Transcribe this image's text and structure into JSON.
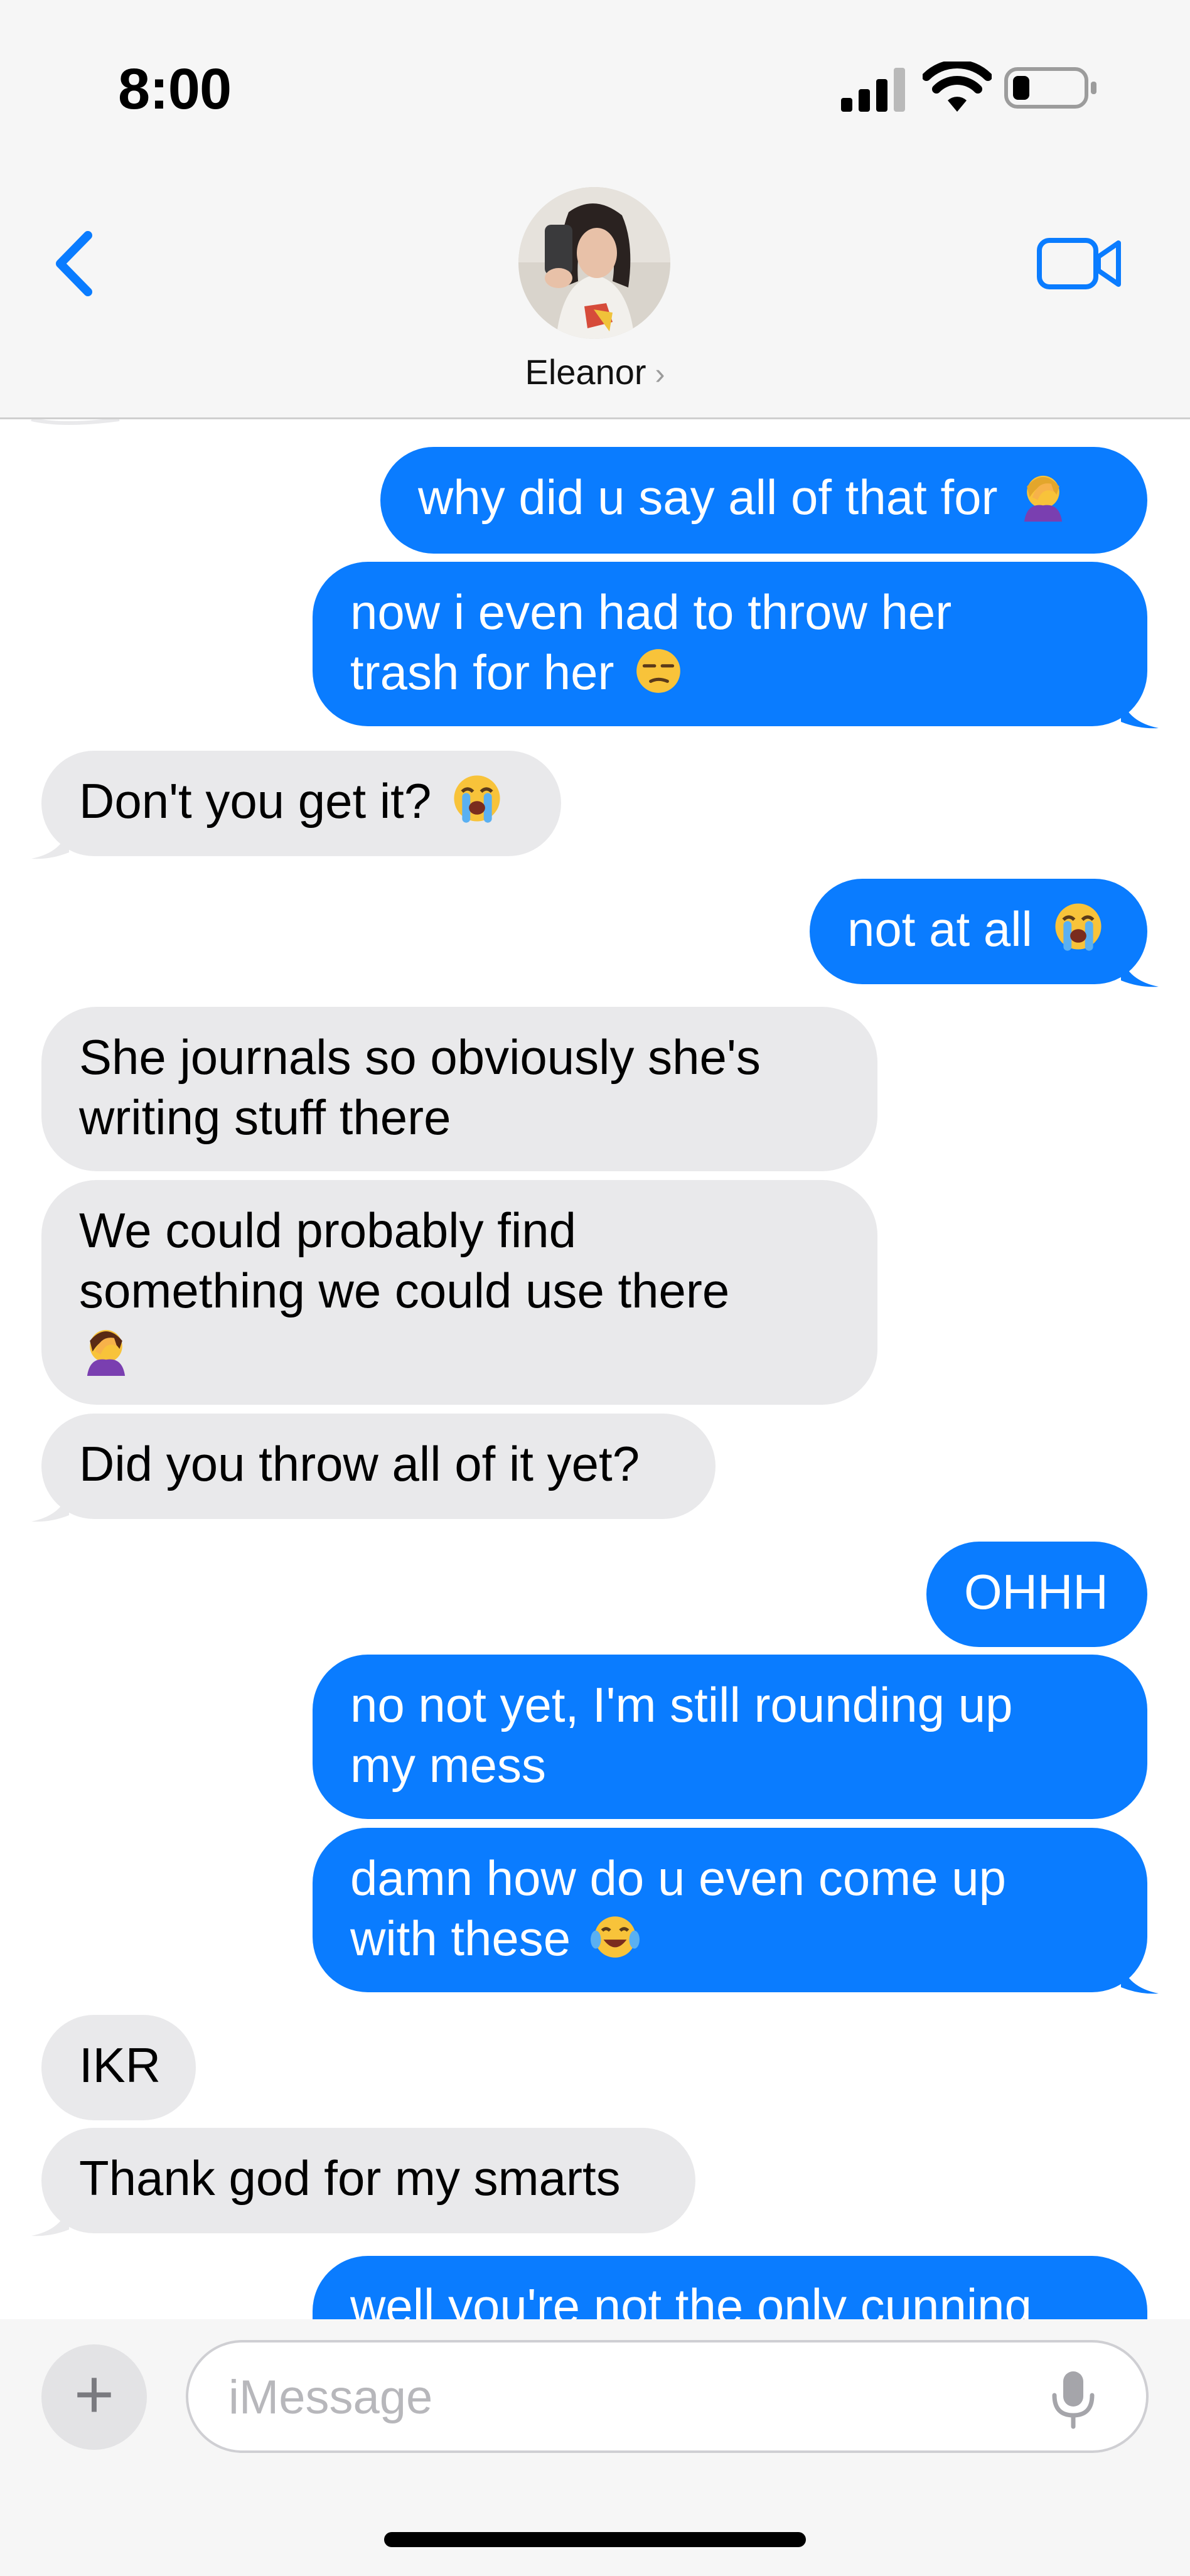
{
  "status_bar": {
    "time": "8:00"
  },
  "header": {
    "contact_name": "Eleanor",
    "contact_chevron": "›",
    "back_icon": "chevron-left-icon",
    "video_icon": "video-camera-icon"
  },
  "messages": [
    {
      "from": "me",
      "text": "why did u say all of that for",
      "emoji": "woman-facepalming"
    },
    {
      "from": "me",
      "text": "now i even had to throw her",
      "text2": "trash for her",
      "emoji": "unamused-face"
    },
    {
      "from": "them",
      "text": "Don't you get it?",
      "emoji": "loudly-crying-face"
    },
    {
      "from": "me",
      "text": "not at all",
      "emoji": "loudly-crying-face"
    },
    {
      "from": "them",
      "text": "She journals so obviously she's",
      "text2": "writing stuff there"
    },
    {
      "from": "them",
      "text": "We could probably find",
      "text2": "something we could use there",
      "emoji": "woman-facepalming"
    },
    {
      "from": "them",
      "text": "Did you throw all of it yet?"
    },
    {
      "from": "me",
      "text": "OHHH"
    },
    {
      "from": "me",
      "text": "no not yet, I'm still rounding up",
      "text2": "my mess"
    },
    {
      "from": "me",
      "text": "damn how do u even come up",
      "text2": "with these",
      "emoji": "face-with-tears-of-joy"
    },
    {
      "from": "them",
      "text": "IKR"
    },
    {
      "from": "them",
      "text": "Thank god for my smarts"
    },
    {
      "from": "me",
      "text": "well you're not the only cunning"
    }
  ],
  "composer": {
    "placeholder": "iMessage",
    "plus_label": "+",
    "mic_icon": "microphone-icon"
  },
  "colors": {
    "outgoing_bubble": "#0a7cff",
    "incoming_bubble": "#e9e9eb",
    "accent": "#0a7cff"
  }
}
